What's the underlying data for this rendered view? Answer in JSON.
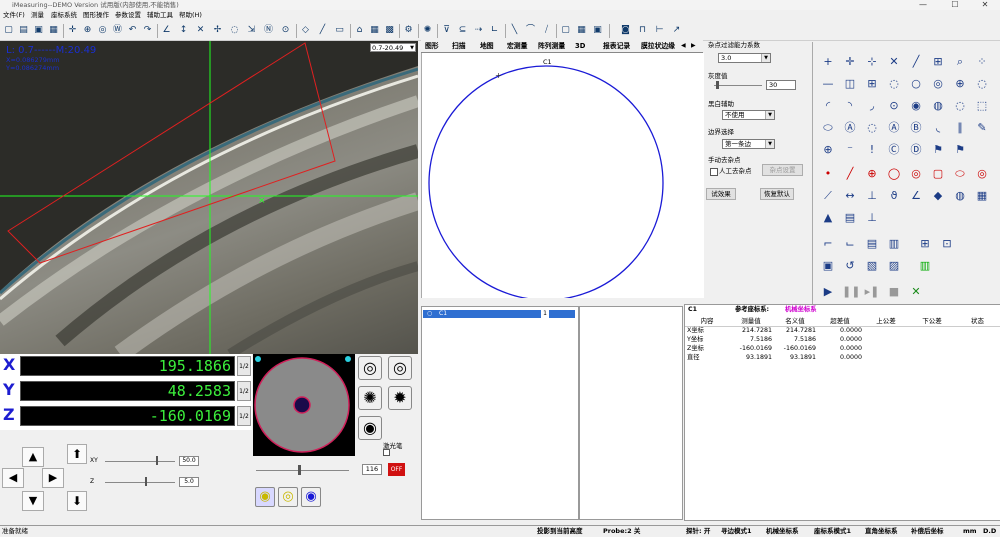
{
  "window": {
    "title": "iMeasuring--DEMO  Version  试用版(内部使用,不能销售)",
    "controls": [
      "—",
      "☐",
      "✕"
    ]
  },
  "menu": [
    "文件(F)",
    "测量",
    "座标系统",
    "图形操作",
    "参数设置",
    "辅助工具",
    "帮助(H)"
  ],
  "camera": {
    "readout_main": "L: 0.7------M:20.49",
    "readout_x": "X=0.086279mm",
    "readout_y": "Y=0.086274mm",
    "zoom_select": "0.7-20.49"
  },
  "tabs": [
    "图形",
    "扫描",
    "地图",
    "宏测量",
    "阵列测量",
    "3D",
    "报表记录",
    "膜拉状边缘"
  ],
  "drawing": {
    "circle_label": "C1"
  },
  "settings": {
    "noise_filter_label": "杂点过滤能力系数",
    "noise_filter_value": "3.0",
    "gray_label": "灰度值",
    "gray_value": "30",
    "bw_label": "黑白辅助",
    "bw_value": "不使用",
    "edge_label": "边界选择",
    "edge_value": "第一条边",
    "manual_label": "手动去杂点",
    "manual_checkbox_label": "人工去杂点",
    "noise_setting_button": "杂点设置",
    "test_button": "试效果",
    "default_button": "恢复默认"
  },
  "coords": {
    "x_label": "X",
    "x_value": "195.1866",
    "y_label": "Y",
    "y_value": "48.2583",
    "z_label": "Z",
    "z_value": "-160.0169",
    "half": "1/2"
  },
  "jog": {
    "xy_label": "XY",
    "xy_value": "50.0",
    "z_label": "Z",
    "z_value": "5.0"
  },
  "light": {
    "value": "116",
    "laser_label": "激光笔"
  },
  "list": {
    "item_name": "C1",
    "item_index": "1"
  },
  "table": {
    "feature": "C1",
    "ref_label": "参考座标系:",
    "ref_value": "机械坐标系",
    "headers": [
      "内容",
      "测量值",
      "名义值",
      "超差值",
      "上公差",
      "下公差",
      "状态"
    ],
    "rows": [
      [
        "X坐标",
        "214.7281",
        "214.7281",
        "0.0000"
      ],
      [
        "Y坐标",
        "7.5186",
        "7.5186",
        "0.0000"
      ],
      [
        "Z坐标",
        "-160.0169",
        "-160.0169",
        "0.0000"
      ],
      [
        "直径",
        "93.1891",
        "93.1891",
        "0.0000"
      ]
    ]
  },
  "status": {
    "ready": "准备就绪",
    "focus": "投影到当前高度",
    "probe": "Probe:2 关",
    "probe_switch": "探针: 开",
    "edge_mode": "寻边模式1",
    "machine_coord": "机械坐标系",
    "coord_mode": "座标系模式1",
    "rect_coord": "直角坐标系",
    "comp": "补偿后坐标",
    "unit": "mm",
    "dd": "D.D"
  },
  "colors": {
    "accent_blue": "#1d1dd0",
    "readout_green": "#3cf03c",
    "circle_blue": "#1a1ad6",
    "list_selected": "#2f6fd1",
    "ref_magenta": "#d000d0"
  }
}
